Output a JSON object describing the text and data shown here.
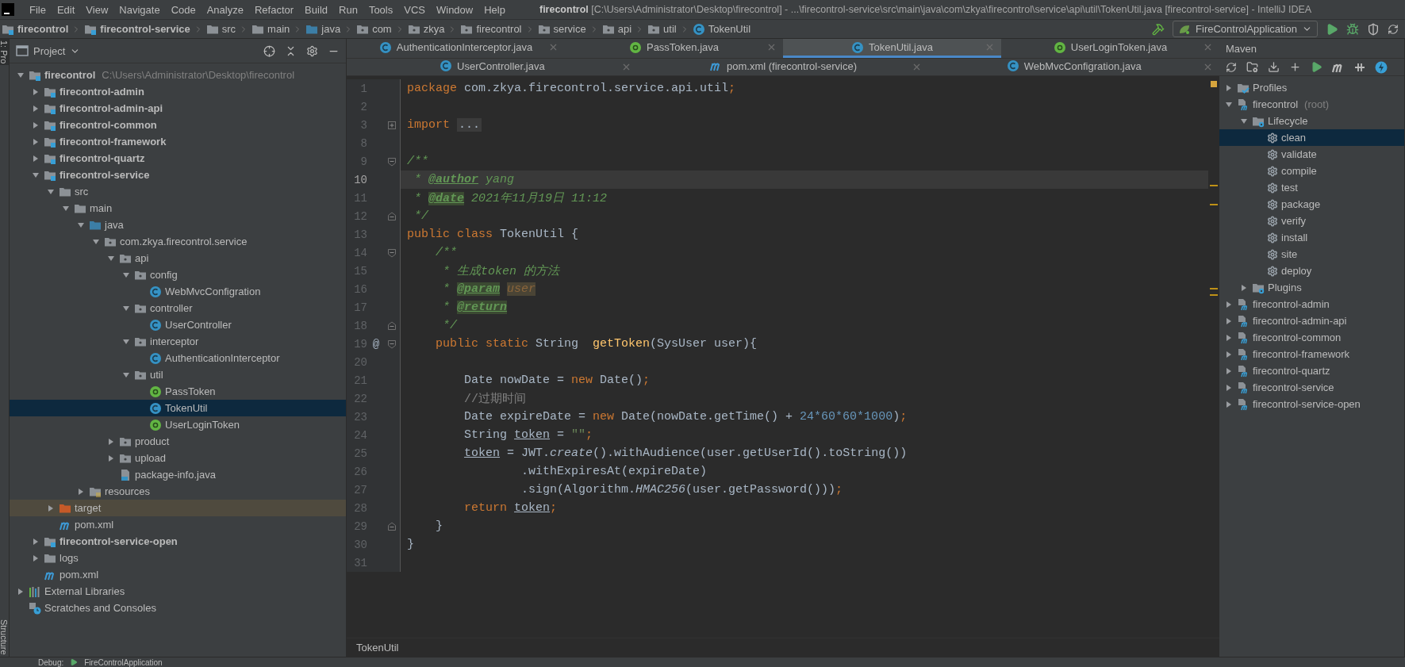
{
  "window": {
    "title": "**firecontrol** [C:\\Users\\Administrator\\Desktop\\firecontrol] - ...\\firecontrol-service\\src\\main\\java\\com\\zkya\\firecontrol\\service\\api\\util\\TokenUtil.java [firecontrol-service] - IntelliJ IDEA"
  },
  "menu": [
    "File",
    "Edit",
    "View",
    "Navigate",
    "Code",
    "Analyze",
    "Refactor",
    "Build",
    "Run",
    "Tools",
    "VCS",
    "Window",
    "Help"
  ],
  "breadcrumbs": [
    {
      "label": "firecontrol",
      "kind": "module"
    },
    {
      "label": "firecontrol-service",
      "kind": "module"
    },
    {
      "label": "src",
      "kind": "folder"
    },
    {
      "label": "main",
      "kind": "folder"
    },
    {
      "label": "java",
      "kind": "source-folder"
    },
    {
      "label": "com",
      "kind": "package"
    },
    {
      "label": "zkya",
      "kind": "package"
    },
    {
      "label": "firecontrol",
      "kind": "package"
    },
    {
      "label": "service",
      "kind": "package"
    },
    {
      "label": "api",
      "kind": "package"
    },
    {
      "label": "util",
      "kind": "package"
    },
    {
      "label": "TokenUtil",
      "kind": "class"
    }
  ],
  "run_config": "FireControlApplication",
  "side_tabs": {
    "top": "1: Pro",
    "bottom": "Structure"
  },
  "project": {
    "title": "Project",
    "tree": [
      {
        "label": "firecontrol",
        "hint": "C:\\Users\\Administrator\\Desktop\\firecontrol",
        "kind": "module",
        "expanded": true,
        "selected": false,
        "children": [
          {
            "label": "firecontrol-admin",
            "kind": "module",
            "expanded": false,
            "selected": false
          },
          {
            "label": "firecontrol-admin-api",
            "kind": "module",
            "expanded": false,
            "selected": false
          },
          {
            "label": "firecontrol-common",
            "kind": "module",
            "expanded": false,
            "selected": false
          },
          {
            "label": "firecontrol-framework",
            "kind": "module",
            "expanded": false,
            "selected": false
          },
          {
            "label": "firecontrol-quartz",
            "kind": "module",
            "expanded": false,
            "selected": false
          },
          {
            "label": "firecontrol-service",
            "kind": "module",
            "expanded": true,
            "selected": false,
            "children": [
              {
                "label": "src",
                "kind": "folder",
                "expanded": true,
                "selected": false,
                "children": [
                  {
                    "label": "main",
                    "kind": "folder",
                    "expanded": true,
                    "selected": false,
                    "children": [
                      {
                        "label": "java",
                        "kind": "source-folder",
                        "expanded": true,
                        "selected": false,
                        "children": [
                          {
                            "label": "com.zkya.firecontrol.service",
                            "kind": "package",
                            "expanded": true,
                            "selected": false,
                            "children": [
                              {
                                "label": "api",
                                "kind": "package",
                                "expanded": true,
                                "selected": false,
                                "children": [
                                  {
                                    "label": "config",
                                    "kind": "package",
                                    "expanded": true,
                                    "selected": false,
                                    "children": [
                                      {
                                        "label": "WebMvcConfigration",
                                        "kind": "class",
                                        "selected": false
                                      }
                                    ]
                                  },
                                  {
                                    "label": "controller",
                                    "kind": "package",
                                    "expanded": true,
                                    "selected": false,
                                    "children": [
                                      {
                                        "label": "UserController",
                                        "kind": "class",
                                        "selected": false
                                      }
                                    ]
                                  },
                                  {
                                    "label": "interceptor",
                                    "kind": "package",
                                    "expanded": true,
                                    "selected": false,
                                    "children": [
                                      {
                                        "label": "AuthenticationInterceptor",
                                        "kind": "class",
                                        "selected": false
                                      }
                                    ]
                                  },
                                  {
                                    "label": "util",
                                    "kind": "package",
                                    "expanded": true,
                                    "selected": false,
                                    "children": [
                                      {
                                        "label": "PassToken",
                                        "kind": "annotation",
                                        "selected": false
                                      },
                                      {
                                        "label": "TokenUtil",
                                        "kind": "class",
                                        "selected": true
                                      },
                                      {
                                        "label": "UserLoginToken",
                                        "kind": "annotation",
                                        "selected": false
                                      }
                                    ]
                                  }
                                ]
                              },
                              {
                                "label": "product",
                                "kind": "package",
                                "expanded": false,
                                "selected": false
                              },
                              {
                                "label": "upload",
                                "kind": "package",
                                "expanded": false,
                                "selected": false
                              },
                              {
                                "label": "package-info.java",
                                "kind": "java-file",
                                "selected": false
                              }
                            ]
                          }
                        ]
                      },
                      {
                        "label": "resources",
                        "kind": "resources",
                        "expanded": false,
                        "selected": false
                      }
                    ]
                  }
                ]
              },
              {
                "label": "target",
                "kind": "excluded",
                "expanded": false,
                "selected": false
              },
              {
                "label": "pom.xml",
                "kind": "maven",
                "selected": false
              }
            ]
          },
          {
            "label": "firecontrol-service-open",
            "kind": "module",
            "expanded": false,
            "selected": false
          },
          {
            "label": "logs",
            "kind": "folder",
            "expanded": false,
            "selected": false
          },
          {
            "label": "pom.xml",
            "kind": "maven",
            "selected": false
          }
        ]
      },
      {
        "label": "External Libraries",
        "kind": "libraries",
        "expanded": false,
        "selected": false
      },
      {
        "label": "Scratches and Consoles",
        "kind": "scratches",
        "selected": false
      }
    ]
  },
  "tab_rows": [
    {
      "tabs": [
        {
          "label": "AuthenticationInterceptor.java",
          "kind": "class",
          "selected": false
        },
        {
          "label": "PassToken.java",
          "kind": "annotation",
          "selected": false
        },
        {
          "label": "TokenUtil.java",
          "kind": "class",
          "selected": true
        },
        {
          "label": "UserLoginToken.java",
          "kind": "annotation",
          "selected": false
        }
      ]
    },
    {
      "tabs": [
        {
          "label": "UserController.java",
          "kind": "class",
          "selected": false
        },
        {
          "label": "pom.xml (firecontrol-service)",
          "kind": "maven",
          "selected": false
        },
        {
          "label": "WebMvcConfigration.java",
          "kind": "class",
          "selected": false
        }
      ]
    }
  ],
  "editor": {
    "lines": [
      {
        "number": "1",
        "current": false,
        "tokens": [
          {
            "kind": "kw",
            "text": "package "
          },
          {
            "kind": "plain",
            "text": "com.zkya.firecontrol.service.api.util"
          },
          {
            "kind": "kw",
            "text": ";"
          }
        ]
      },
      {
        "number": "2",
        "current": false
      },
      {
        "number": "3",
        "current": false,
        "fold": {
          "kind": "collapsed"
        },
        "tokens": [
          {
            "kind": "kw",
            "text": "import "
          },
          {
            "kind": "folded",
            "text": "..."
          }
        ]
      },
      {
        "number": "8",
        "current": false
      },
      {
        "number": "9",
        "current": false,
        "fold": {
          "kind": "open"
        },
        "tokens": [
          {
            "kind": "doc",
            "text": "/**"
          }
        ]
      },
      {
        "number": "10",
        "current": true,
        "tokens": [
          {
            "kind": "doc",
            "text": " * "
          },
          {
            "kind": "doctag",
            "text": "@author"
          },
          {
            "kind": "doc",
            "text": " yang"
          }
        ]
      },
      {
        "number": "11",
        "current": false,
        "tokens": [
          {
            "kind": "doc",
            "text": " * "
          },
          {
            "kind": "doctag-hl",
            "text": "@date"
          },
          {
            "kind": "doc",
            "text": " 2021年11月19日 11:12"
          }
        ]
      },
      {
        "number": "12",
        "current": false,
        "fold": {
          "kind": "close"
        },
        "tokens": [
          {
            "kind": "doc",
            "text": " */"
          }
        ]
      },
      {
        "number": "13",
        "current": false,
        "tokens": [
          {
            "kind": "kw",
            "text": "public class "
          },
          {
            "kind": "plain",
            "text": "TokenUtil {"
          }
        ]
      },
      {
        "number": "14",
        "current": false,
        "fold": {
          "kind": "open"
        },
        "tokens": [
          {
            "kind": "doc",
            "text": "    /**"
          }
        ]
      },
      {
        "number": "15",
        "current": false,
        "tokens": [
          {
            "kind": "doc",
            "text": "     * 生成token 的方法"
          }
        ]
      },
      {
        "number": "16",
        "current": false,
        "tokens": [
          {
            "kind": "doc",
            "text": "     * "
          },
          {
            "kind": "doctag-hl",
            "text": "@param"
          },
          {
            "kind": "docparam",
            "text": " user"
          }
        ]
      },
      {
        "number": "17",
        "current": false,
        "tokens": [
          {
            "kind": "doc",
            "text": "     * "
          },
          {
            "kind": "doctag-hl",
            "text": "@return"
          }
        ]
      },
      {
        "number": "18",
        "current": false,
        "fold": {
          "kind": "close"
        },
        "tokens": [
          {
            "kind": "doc",
            "text": "     */"
          }
        ]
      },
      {
        "number": "19",
        "current": false,
        "gutter_mark": "@",
        "fold": {
          "kind": "open"
        },
        "tokens": [
          {
            "kind": "kw",
            "text": "    public static "
          },
          {
            "kind": "plain",
            "text": "String  "
          },
          {
            "kind": "fn",
            "text": "getToken"
          },
          {
            "kind": "plain",
            "text": "(SysUser user){"
          }
        ]
      },
      {
        "number": "20",
        "current": false
      },
      {
        "number": "21",
        "current": false,
        "tokens": [
          {
            "kind": "plain",
            "text": "        Date nowDate = "
          },
          {
            "kind": "kw",
            "text": "new "
          },
          {
            "kind": "plain",
            "text": "Date()"
          },
          {
            "kind": "kw",
            "text": ";"
          }
        ]
      },
      {
        "number": "22",
        "current": false,
        "tokens": [
          {
            "kind": "comment",
            "text": "        //过期时间"
          }
        ]
      },
      {
        "number": "23",
        "current": false,
        "tokens": [
          {
            "kind": "plain",
            "text": "        Date expireDate = "
          },
          {
            "kind": "kw",
            "text": "new "
          },
          {
            "kind": "plain",
            "text": "Date(nowDate.getTime() + "
          },
          {
            "kind": "num",
            "text": "24*60*60*1000"
          },
          {
            "kind": "plain",
            "text": ")"
          },
          {
            "kind": "kw",
            "text": ";"
          }
        ]
      },
      {
        "number": "24",
        "current": false,
        "tokens": [
          {
            "kind": "plain",
            "text": "        String "
          },
          {
            "kind": "var",
            "text": "token"
          },
          {
            "kind": "plain",
            "text": " = "
          },
          {
            "kind": "str",
            "text": "\"\""
          },
          {
            "kind": "kw",
            "text": ";"
          }
        ]
      },
      {
        "number": "25",
        "current": false,
        "tokens": [
          {
            "kind": "var",
            "text": "        token"
          },
          {
            "kind": "plain",
            "text": " = JWT."
          },
          {
            "kind": "ital",
            "text": "create"
          },
          {
            "kind": "plain",
            "text": "().withAudience(user.getUserId().toString())"
          }
        ]
      },
      {
        "number": "26",
        "current": false,
        "tokens": [
          {
            "kind": "plain",
            "text": "                .withExpiresAt(expireDate)"
          }
        ]
      },
      {
        "number": "27",
        "current": false,
        "tokens": [
          {
            "kind": "plain",
            "text": "                .sign(Algorithm."
          },
          {
            "kind": "ital",
            "text": "HMAC256"
          },
          {
            "kind": "plain",
            "text": "(user.getPassword()))"
          },
          {
            "kind": "kw",
            "text": ";"
          }
        ]
      },
      {
        "number": "28",
        "current": false,
        "tokens": [
          {
            "kind": "kw",
            "text": "        return "
          },
          {
            "kind": "var",
            "text": "token"
          },
          {
            "kind": "kw",
            "text": ";"
          }
        ]
      },
      {
        "number": "29",
        "current": false,
        "fold": {
          "kind": "close"
        },
        "tokens": [
          {
            "kind": "plain",
            "text": "    }"
          }
        ]
      },
      {
        "number": "30",
        "current": false,
        "tokens": [
          {
            "kind": "plain",
            "text": "}"
          }
        ]
      },
      {
        "number": "31",
        "current": false
      }
    ],
    "breadcrumb": "TokenUtil"
  },
  "maven": {
    "title": "Maven",
    "tree": [
      {
        "label": "Profiles",
        "kind": "profiles",
        "expanded": false,
        "selected": false
      },
      {
        "label": "firecontrol",
        "hint": "(root)",
        "kind": "maven-module",
        "expanded": true,
        "selected": false,
        "children": [
          {
            "label": "Lifecycle",
            "kind": "lifecycle",
            "expanded": true,
            "selected": false,
            "children": [
              {
                "label": "clean",
                "kind": "goal",
                "selected": true
              },
              {
                "label": "validate",
                "kind": "goal",
                "selected": false
              },
              {
                "label": "compile",
                "kind": "goal",
                "selected": false
              },
              {
                "label": "test",
                "kind": "goal",
                "selected": false
              },
              {
                "label": "package",
                "kind": "goal",
                "selected": false
              },
              {
                "label": "verify",
                "kind": "goal",
                "selected": false
              },
              {
                "label": "install",
                "kind": "goal",
                "selected": false
              },
              {
                "label": "site",
                "kind": "goal",
                "selected": false
              },
              {
                "label": "deploy",
                "kind": "goal",
                "selected": false
              }
            ]
          },
          {
            "label": "Plugins",
            "kind": "lifecycle",
            "expanded": false,
            "selected": false
          }
        ]
      },
      {
        "label": "firecontrol-admin",
        "kind": "maven-module",
        "expanded": false,
        "selected": false
      },
      {
        "label": "firecontrol-admin-api",
        "kind": "maven-module",
        "expanded": false,
        "selected": false
      },
      {
        "label": "firecontrol-common",
        "kind": "maven-module",
        "expanded": false,
        "selected": false
      },
      {
        "label": "firecontrol-framework",
        "kind": "maven-module",
        "expanded": false,
        "selected": false
      },
      {
        "label": "firecontrol-quartz",
        "kind": "maven-module",
        "expanded": false,
        "selected": false
      },
      {
        "label": "firecontrol-service",
        "kind": "maven-module",
        "expanded": false,
        "selected": false
      },
      {
        "label": "firecontrol-service-open",
        "kind": "maven-module",
        "expanded": false,
        "selected": false
      }
    ]
  },
  "bottom_bar": {
    "tool": "Debug:",
    "session": "FireControlApplication"
  }
}
